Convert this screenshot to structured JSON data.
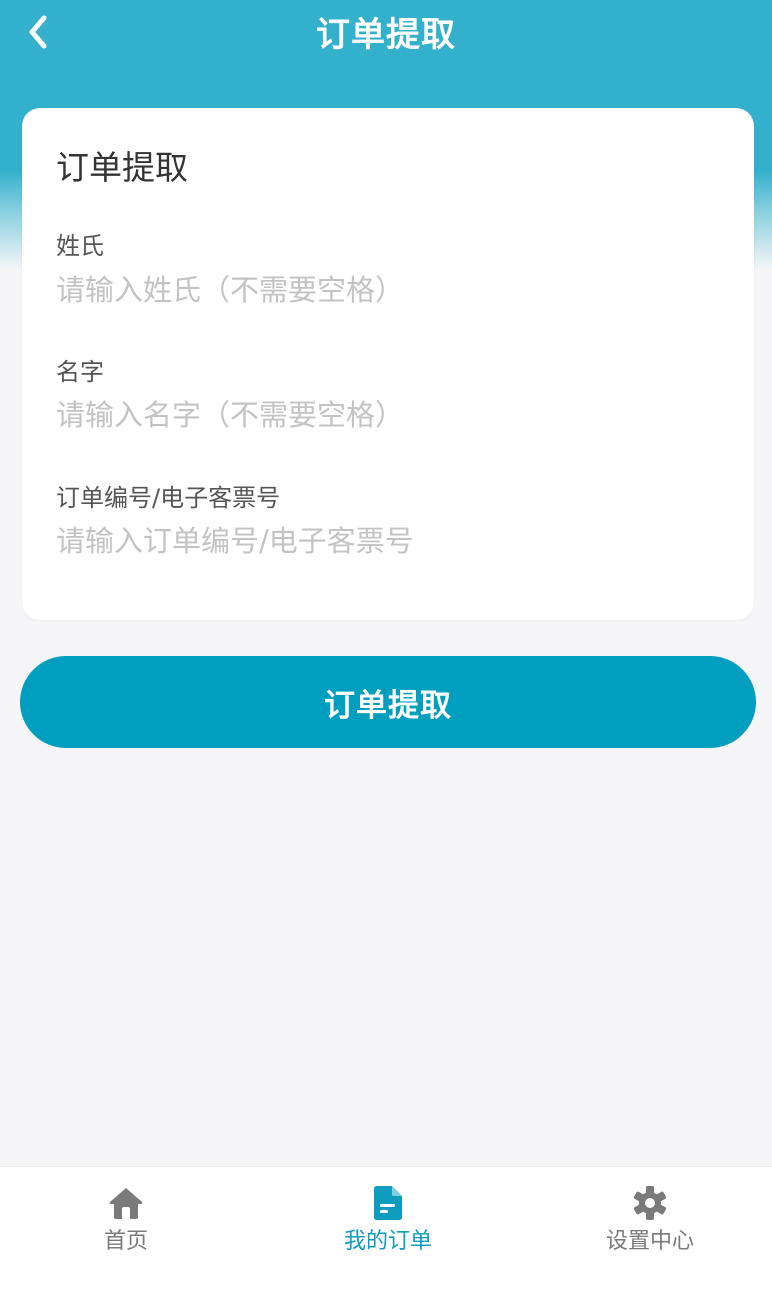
{
  "header": {
    "title": "订单提取",
    "back_icon": "chevron-left-icon"
  },
  "form": {
    "title": "订单提取",
    "fields": [
      {
        "label": "姓氏",
        "value": "",
        "placeholder": "请输入姓氏（不需要空格）"
      },
      {
        "label": "名字",
        "value": "",
        "placeholder": "请输入名字（不需要空格）"
      },
      {
        "label": "订单编号/电子客票号",
        "value": "",
        "placeholder": "请输入订单编号/电子客票号"
      }
    ],
    "submit_label": "订单提取"
  },
  "tabbar": {
    "items": [
      {
        "label": "首页",
        "icon": "home-icon",
        "active": false
      },
      {
        "label": "我的订单",
        "icon": "order-icon",
        "active": true
      },
      {
        "label": "设置中心",
        "icon": "gear-icon",
        "active": false
      }
    ]
  },
  "colors": {
    "header_bg": "#33b0cc",
    "primary": "#009ebf",
    "active_tab": "#0e9cbf",
    "inactive_tab": "#7a7a7a",
    "page_bg": "#f5f5f7"
  }
}
